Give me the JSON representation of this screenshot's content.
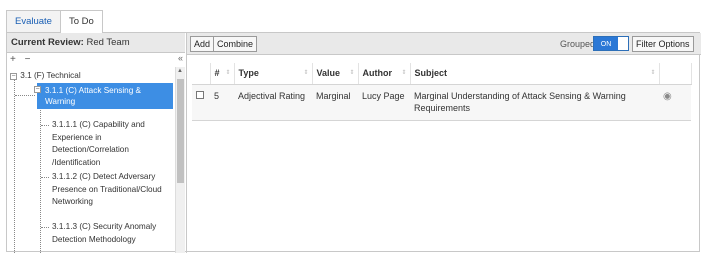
{
  "tabs": [
    {
      "label": "Evaluate"
    },
    {
      "label": "To Do"
    }
  ],
  "review": {
    "label": "Current Review:",
    "name": "Red Team"
  },
  "tree_tools": {
    "add": "+",
    "remove": "−",
    "collapse": "«"
  },
  "tree": {
    "root": {
      "label": "3.1 (F) Technical",
      "expanded": true
    },
    "selected": {
      "label": "3.1.1 (C) Attack Sensing & Warning",
      "expanded": true
    },
    "leaves": [
      {
        "label": "3.1.1.1 (C) Capability and Experience in Detection/Correlation /Identification"
      },
      {
        "label": "3.1.1.2 (C) Detect Adversary Presence on Traditional/Cloud Networking"
      },
      {
        "label": "3.1.1.3 (C) Security Anomaly Detection Methodology"
      }
    ]
  },
  "toolbar": {
    "add_label": "Add",
    "combine_label": "Combine",
    "grouped_label": "Grouped",
    "toggle_state": "ON",
    "filter_label": "Filter Options"
  },
  "grid": {
    "columns": [
      "#",
      "Type",
      "Value",
      "Author",
      "Subject"
    ],
    "rows": [
      {
        "num": "5",
        "type": "Adjectival Rating",
        "value": "Marginal",
        "author": "Lucy Page",
        "subject": "Marginal Understanding of Attack Sensing & Warning Requirements",
        "action_icon": "eye-icon"
      }
    ]
  }
}
